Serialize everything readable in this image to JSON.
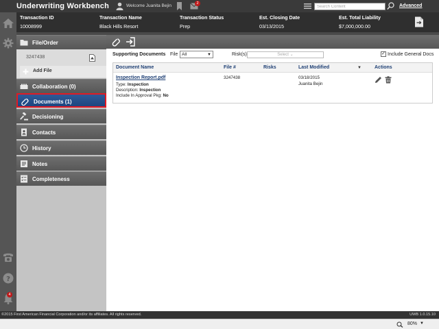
{
  "app": {
    "title": "Underwriting Workbench",
    "welcome": "Welcome Juanita Bejin",
    "mail_count": "2",
    "search_placeholder": "Search Content",
    "advanced_label": "Advanced"
  },
  "transaction": {
    "columns": [
      {
        "label": "Transaction ID",
        "value": "10008999"
      },
      {
        "label": "Transaction Name",
        "value": "Black Hills Resort"
      },
      {
        "label": "Transaction Status",
        "value": "Prep"
      },
      {
        "label": "Est. Closing Date",
        "value": "03/13/2015"
      },
      {
        "label": "Est. Total Liability",
        "value": "$7,000,000.00"
      }
    ]
  },
  "sidebar": {
    "file_order_label": "File/Order",
    "file_number": "3247438",
    "add_file_label": "Add File",
    "items": [
      {
        "label": "Collaboration (0)",
        "icon": "collaboration-icon"
      },
      {
        "label": "Documents (1)",
        "icon": "link-icon",
        "active": true
      },
      {
        "label": "Decisioning",
        "icon": "gavel-icon"
      },
      {
        "label": "Contacts",
        "icon": "contacts-icon"
      },
      {
        "label": "History",
        "icon": "clock-icon"
      },
      {
        "label": "Notes",
        "icon": "notes-icon"
      },
      {
        "label": "Completeness",
        "icon": "checklist-icon"
      }
    ]
  },
  "documents": {
    "supporting_label": "Supporting Documents",
    "file_label": "File",
    "file_value": "All",
    "risks_label": "Risk(s)",
    "risks_placeholder": "Select",
    "include_general_label": "Include General Docs",
    "include_general_checked": true,
    "headers": {
      "name": "Document Name",
      "file": "File #",
      "risks": "Risks",
      "modified": "Last Modified",
      "actions": "Actions"
    },
    "rows": [
      {
        "name": "Inspection Report.pdf",
        "type_label": "Type:",
        "type": "Inspection",
        "desc_label": "Description:",
        "description": "Inspection",
        "approval_label": "Include In Approval Pkg:",
        "approval": "No",
        "file": "3247438",
        "risks": "",
        "modified_date": "03/18/2015",
        "modified_by": "Juanita Bejin"
      }
    ]
  },
  "footer": {
    "copyright": "©2015 First American Financial Corporation and/or its affiliates. All rights reserved.",
    "version": "UWB 1.0.15.10"
  },
  "status": {
    "zoom": "80%",
    "notification_count": "4"
  },
  "colors": {
    "active_nav": "#1e4680",
    "active_outline": "#e21a23",
    "link_text": "#1e3f74",
    "badge": "#c0191a"
  }
}
